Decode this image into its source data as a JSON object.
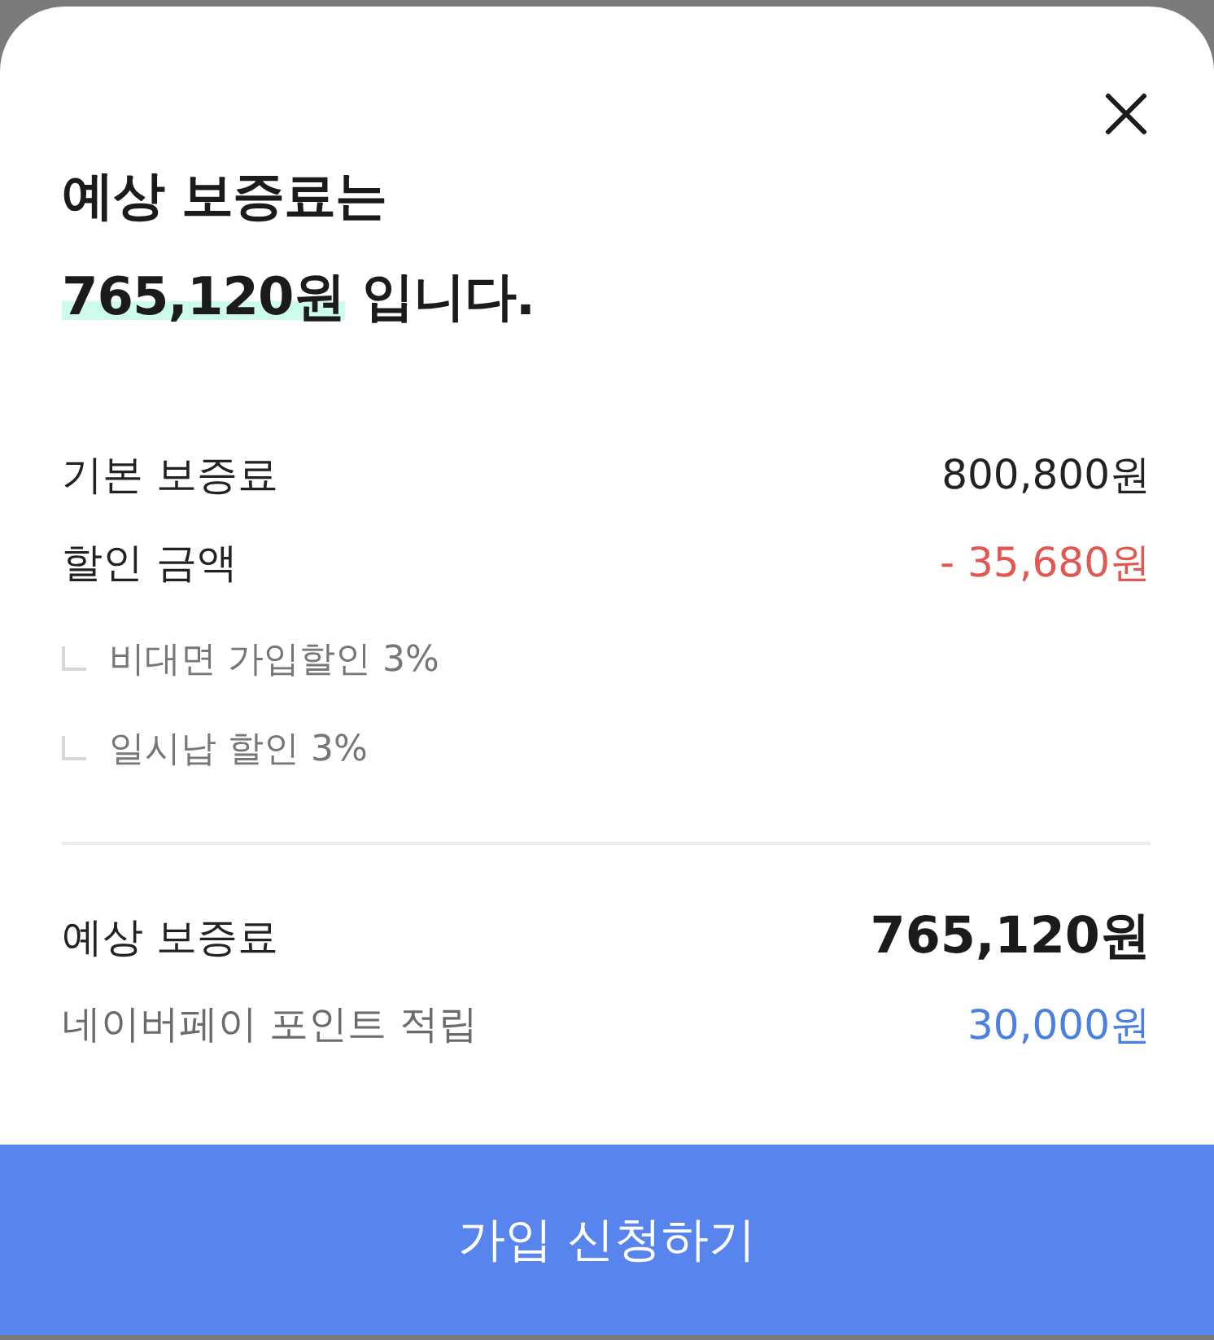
{
  "headline": {
    "intro": "예상 보증료는",
    "amount": "765,120원",
    "ending": "입니다."
  },
  "charges": [
    {
      "kind": "plain",
      "label": "기본 보증료",
      "amount": "800,800원"
    },
    {
      "kind": "discount",
      "label": "할인 금액",
      "amount": "- 35,680원"
    }
  ],
  "discount_details": [
    "비대면 가입할인 3%",
    "일시납 할인 3%"
  ],
  "summary": [
    {
      "kind": "total",
      "label": "예상 보증료",
      "amount": "765,120원"
    },
    {
      "kind": "reward",
      "label": "네이버페이 포인트 적립",
      "amount": "30,000원"
    }
  ],
  "primary_button": {
    "label": "가입 신청하기"
  }
}
